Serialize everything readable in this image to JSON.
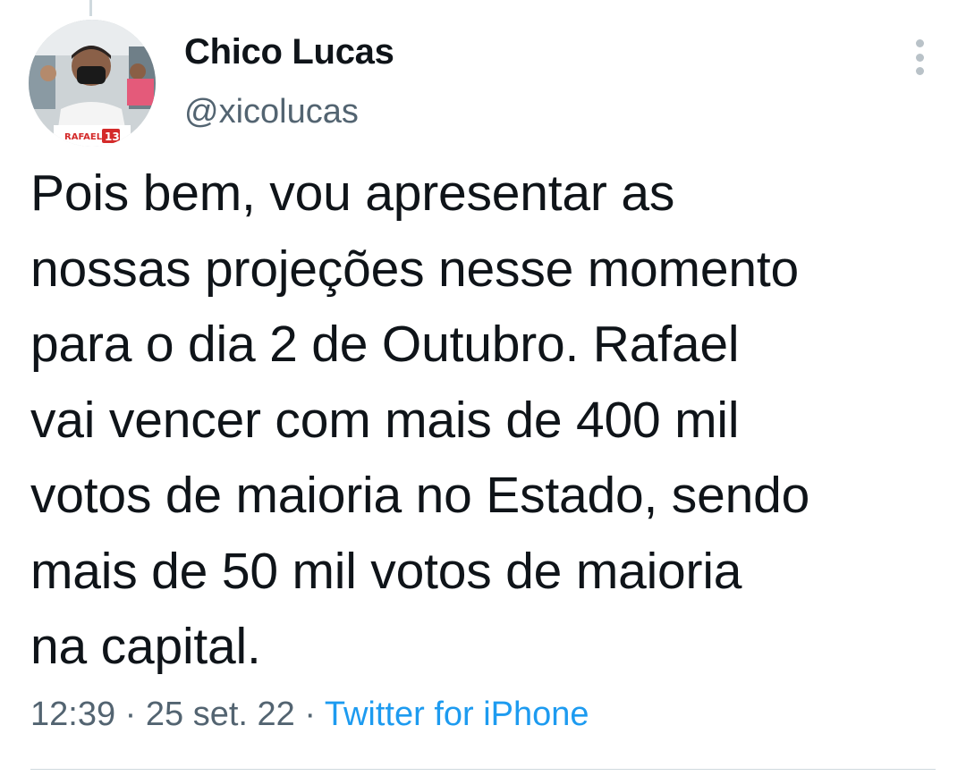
{
  "tweet": {
    "author": {
      "display_name": "Chico Lucas",
      "handle": "@xicolucas",
      "avatar_badge_text": "RAFAEL",
      "avatar_badge_number": "13"
    },
    "text": "Pois bem, vou apresentar as\nnossas projeções nesse momento\npara o dia 2 de Outubro. Rafael\nvai vencer com mais de 400 mil\nvotos de maioria no Estado, sendo\nmais de 50 mil votos de maioria\nna capital.",
    "time": "12:39",
    "separator": " · ",
    "date": "25 set. 22",
    "source": "Twitter for iPhone"
  },
  "icons": {
    "more": "more-vertical-icon"
  },
  "colors": {
    "text": "#0f1419",
    "secondary": "#536471",
    "link": "#1d9bf0",
    "divider": "#cfd9de"
  }
}
